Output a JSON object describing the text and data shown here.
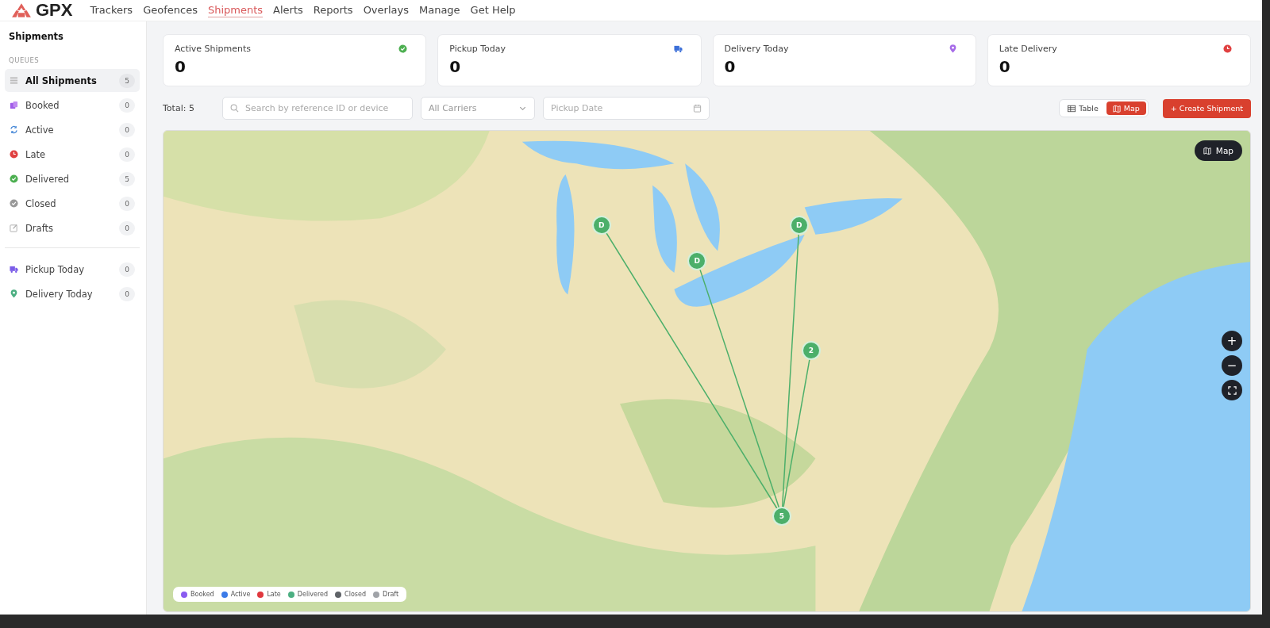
{
  "brand": "GPX",
  "nav": [
    {
      "label": "Trackers",
      "selected": false
    },
    {
      "label": "Geofences",
      "selected": false
    },
    {
      "label": "Shipments",
      "selected": true
    },
    {
      "label": "Alerts",
      "selected": false
    },
    {
      "label": "Reports",
      "selected": false
    },
    {
      "label": "Overlays",
      "selected": false
    },
    {
      "label": "Manage",
      "selected": false
    },
    {
      "label": "Get Help",
      "selected": false
    }
  ],
  "sidebar": {
    "title": "Shipments",
    "section": "QUEUES",
    "queues": [
      {
        "label": "All Shipments",
        "count": "5",
        "selected": true
      },
      {
        "label": "Booked",
        "count": "0",
        "selected": false
      },
      {
        "label": "Active",
        "count": "0",
        "selected": false
      },
      {
        "label": "Late",
        "count": "0",
        "selected": false
      },
      {
        "label": "Delivered",
        "count": "5",
        "selected": false
      },
      {
        "label": "Closed",
        "count": "0",
        "selected": false
      },
      {
        "label": "Drafts",
        "count": "0",
        "selected": false
      }
    ],
    "today": [
      {
        "label": "Pickup Today",
        "count": "0",
        "selected": false
      },
      {
        "label": "Delivery Today",
        "count": "0",
        "selected": false
      }
    ]
  },
  "stats": [
    {
      "label": "Active Shipments",
      "value": "0"
    },
    {
      "label": "Pickup Today",
      "value": "0"
    },
    {
      "label": "Delivery Today",
      "value": "0"
    },
    {
      "label": "Late Delivery",
      "value": "0"
    }
  ],
  "toolbar": {
    "total": "Total: 5",
    "search": {
      "placeholder": "Search by reference ID or device"
    },
    "carrier": {
      "value": "All Carriers"
    },
    "date": {
      "placeholder": "Pickup Date"
    },
    "views": [
      {
        "label": "Table",
        "selected": false
      },
      {
        "label": "Map",
        "selected": true
      }
    ],
    "create": "+ Create Shipment"
  },
  "map": {
    "style_button": "Map",
    "markers": [
      {
        "label": "D"
      },
      {
        "label": "D"
      },
      {
        "label": "D"
      },
      {
        "label": "2"
      },
      {
        "label": "5"
      }
    ],
    "zoom_controls": [
      "+",
      "−"
    ],
    "legend": [
      {
        "label": "Booked",
        "color": "#8a5cf0"
      },
      {
        "label": "Active",
        "color": "#3b7be8"
      },
      {
        "label": "Late",
        "color": "#e0383e"
      },
      {
        "label": "Delivered",
        "color": "#4caf82"
      },
      {
        "label": "Closed",
        "color": "#5f6368"
      },
      {
        "label": "Draft",
        "color": "#a0a3a8"
      }
    ]
  }
}
